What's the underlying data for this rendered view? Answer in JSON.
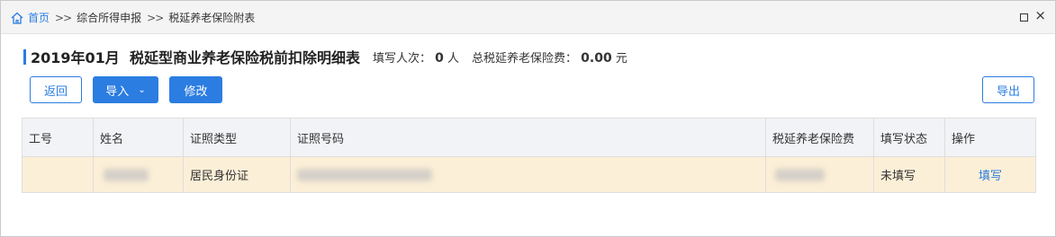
{
  "breadcrumb": {
    "home": "首页",
    "separator": ">>",
    "item1": "综合所得申报",
    "item2": "税延养老保险附表"
  },
  "header": {
    "title": "2019年01月  税延型商业养老保险税前扣除明细表",
    "count_label": "填写人次：",
    "count_value": "0",
    "count_unit": "人",
    "total_label": "总税延养老保险费：",
    "total_value": "0.00",
    "total_unit": "元"
  },
  "toolbar": {
    "back": "返回",
    "import": "导入",
    "modify": "修改",
    "export": "导出"
  },
  "table": {
    "columns": [
      "工号",
      "姓名",
      "证照类型",
      "证照号码",
      "税延养老保险费",
      "填写状态",
      "操作"
    ],
    "rows": [
      {
        "id_type": "居民身份证",
        "status": "未填写",
        "action": "填写"
      }
    ]
  },
  "colors": {
    "accent": "#2b7de1",
    "row_highlight": "#fcefd7",
    "header_bg": "#f1f3f6"
  },
  "icons": {
    "home": "home-icon",
    "maximize": "maximize-icon",
    "close": "close-icon",
    "dropdown": "chevron-down-icon"
  }
}
